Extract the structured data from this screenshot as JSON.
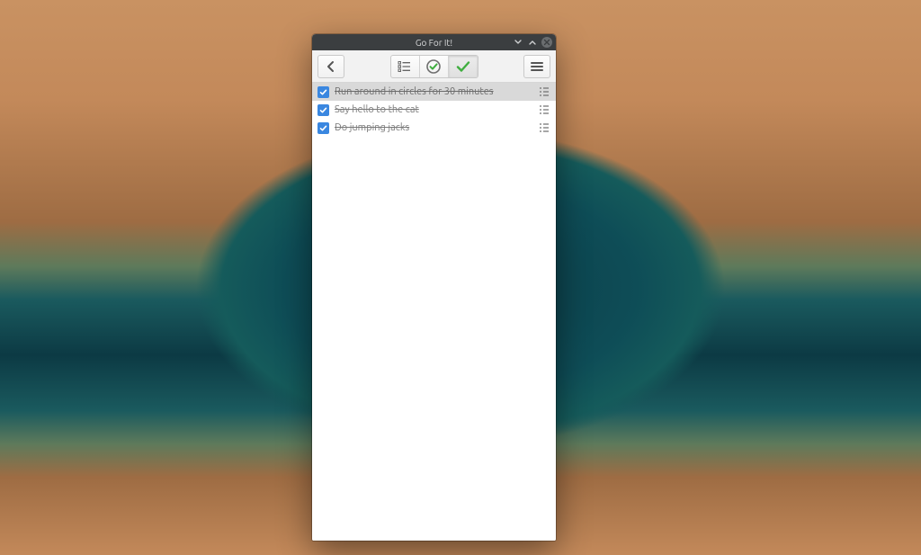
{
  "window": {
    "title": "Go For It!"
  },
  "toolbar": {
    "back": "back-icon",
    "view_todo": "list-icon",
    "view_timer": "timer-check-icon",
    "view_done": "check-icon",
    "menu": "hamburger-icon",
    "active_view": "done"
  },
  "tasks": [
    {
      "label": "Run around in circles for 30 minutes",
      "done": true,
      "selected": true
    },
    {
      "label": "Say hello to the cat",
      "done": true,
      "selected": false
    },
    {
      "label": "Do jumping jacks",
      "done": true,
      "selected": false
    }
  ],
  "colors": {
    "accent": "#3a87e0",
    "done_check": "#3fae3f",
    "titlebar": "#3b3e40"
  }
}
